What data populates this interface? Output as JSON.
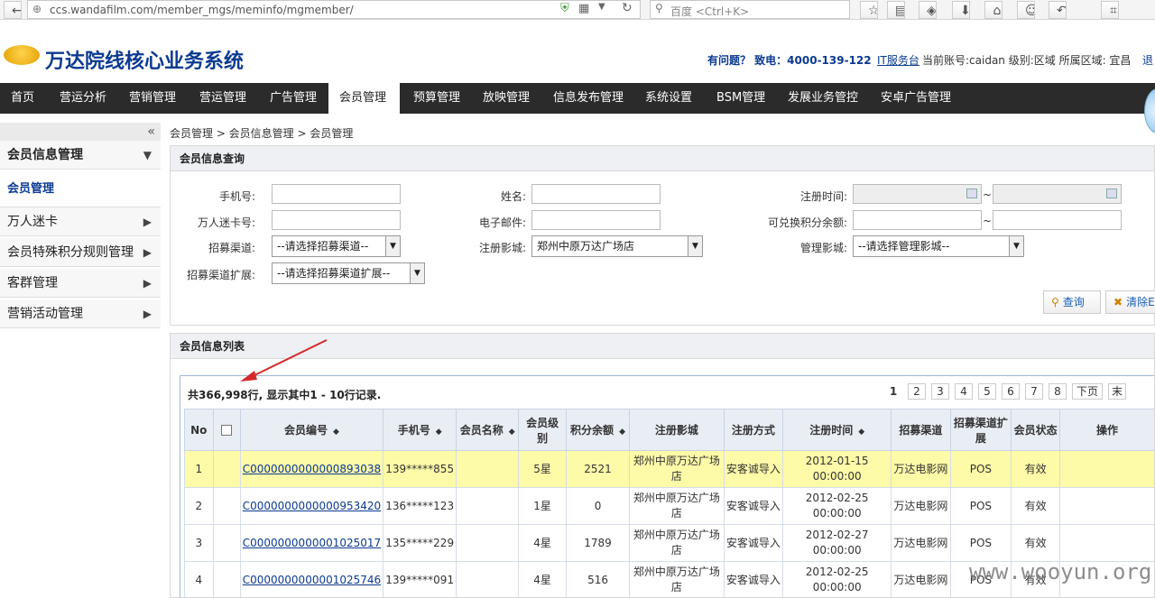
{
  "browser": {
    "url": "ccs.wandafilm.com/member_mgs/meminfo/mgmember/",
    "search_placeholder": "百度 <Ctrl+K>"
  },
  "header": {
    "system_title": "万达院线核心业务系统",
    "help_text": "有问题？ 致电：4000-139-122",
    "it_link": "IT服务台",
    "account_info": "当前账号:caidan 级别:区域 所属区域: 宜昌",
    "exit_text": "退"
  },
  "nav": [
    "首页",
    "营运分析",
    "营销管理",
    "营运管理",
    "广告管理",
    "会员管理",
    "预算管理",
    "放映管理",
    "信息发布管理",
    "系统设置",
    "BSM管理",
    "发展业务管控",
    "安卓广告管理"
  ],
  "nav_active_index": 5,
  "sidebar": {
    "collapse_glyph": "«",
    "items": [
      {
        "label": "会员信息管理",
        "arrow": "▼"
      },
      {
        "label": "万人迷卡",
        "arrow": "▶"
      },
      {
        "label": "会员特殊积分规则管理",
        "arrow": "▶"
      },
      {
        "label": "客群管理",
        "arrow": "▶"
      },
      {
        "label": "营销活动管理",
        "arrow": "▶"
      }
    ],
    "sub_active": "会员管理"
  },
  "breadcrumb": "会员管理 > 会员信息管理 > 会员管理",
  "query": {
    "title": "会员信息查询",
    "labels": {
      "phone": "手机号:",
      "name": "姓名:",
      "reg_time": "注册时间:",
      "card_no": "万人迷卡号:",
      "email": "电子邮件:",
      "points_balance": "可兑换积分余额:",
      "channel": "招募渠道:",
      "reg_cinema": "注册影城:",
      "manage_cinema": "管理影城:",
      "channel_ext": "招募渠道扩展:"
    },
    "tilde": "~",
    "channel_value": "--请选择招募渠道--",
    "reg_cinema_value": "郑州中原万达广场店",
    "manage_cinema_value": "--请选择管理影城--",
    "channel_ext_value": "--请选择招募渠道扩展--",
    "btn_query": "查询",
    "btn_clear": "清除E"
  },
  "list": {
    "title": "会员信息列表",
    "summary": "共366,998行, 显示其中1 - 10行记录.",
    "pages": [
      "1",
      "2",
      "3",
      "4",
      "5",
      "6",
      "7",
      "8",
      "下页",
      "末"
    ],
    "columns": [
      "No",
      "",
      "会员编号",
      "手机号",
      "会员名称",
      "会员级别",
      "积分余额",
      "注册影城",
      "注册方式",
      "注册时间",
      "招募渠道",
      "招募渠道扩展",
      "会员状态",
      "操作"
    ],
    "rows": [
      {
        "no": "1",
        "id": "C0000000000000893038",
        "phone": "139*****855",
        "name": "",
        "level": "5星",
        "points": "2521",
        "cinema": "郑州中原万达广场店",
        "method": "安客诚导入",
        "time": "2012-01-15 00:00:00",
        "channel": "万达电影网",
        "ext": "POS",
        "status": "有效"
      },
      {
        "no": "2",
        "id": "C0000000000000953420",
        "phone": "136*****123",
        "name": "",
        "level": "1星",
        "points": "0",
        "cinema": "郑州中原万达广场店",
        "method": "安客诚导入",
        "time": "2012-02-25 00:00:00",
        "channel": "万达电影网",
        "ext": "POS",
        "status": "有效"
      },
      {
        "no": "3",
        "id": "C0000000000001025017",
        "phone": "135*****229",
        "name": "",
        "level": "4星",
        "points": "1789",
        "cinema": "郑州中原万达广场店",
        "method": "安客诚导入",
        "time": "2012-02-27 00:00:00",
        "channel": "万达电影网",
        "ext": "POS",
        "status": "有效"
      },
      {
        "no": "4",
        "id": "C0000000000001025746",
        "phone": "139*****091",
        "name": "",
        "level": "4星",
        "points": "516",
        "cinema": "郑州中原万达广场店",
        "method": "安客诚导入",
        "time": "2012-02-25 00:00:00",
        "channel": "万达电影网",
        "ext": "POS",
        "status": "有效"
      }
    ]
  },
  "watermark": "www.wooyun.org",
  "colors": {
    "nav_bg": "#2b2b2b",
    "brand": "#0b3a91",
    "row_highlight": "#fdfaa8",
    "arrow": "#d42a2a"
  }
}
